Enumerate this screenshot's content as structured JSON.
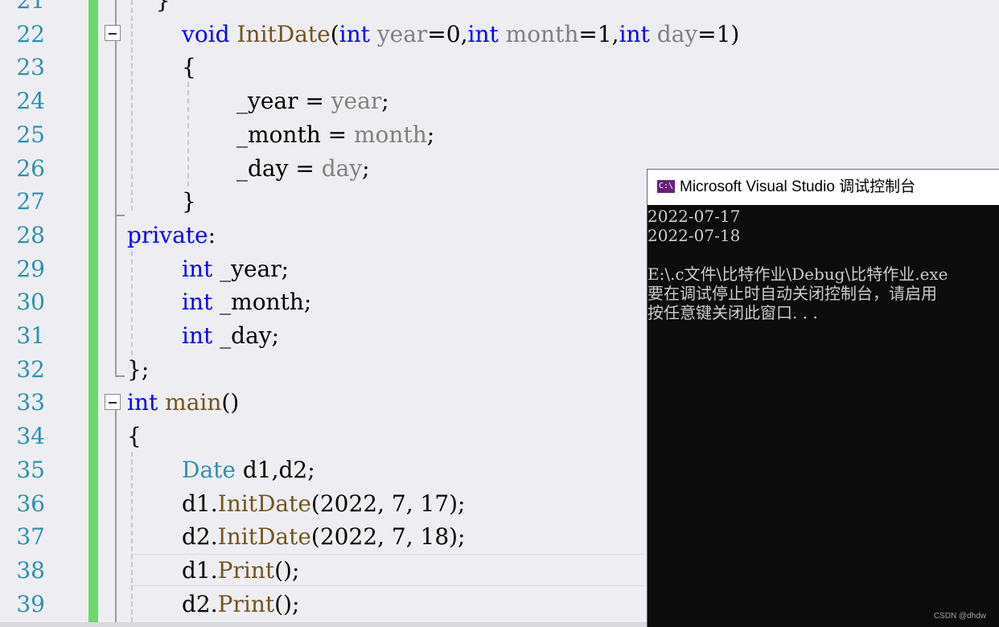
{
  "editor": {
    "lines": [
      {
        "num": "21",
        "code": [
          {
            "t": "    }",
            "c": ""
          }
        ]
      },
      {
        "num": "22",
        "code": [
          {
            "t": "void",
            "c": "kw"
          },
          {
            "t": " ",
            "c": ""
          },
          {
            "t": "InitDate",
            "c": "fn"
          },
          {
            "t": "(",
            "c": ""
          },
          {
            "t": "int",
            "c": "kw"
          },
          {
            "t": " ",
            "c": ""
          },
          {
            "t": "year",
            "c": "prm"
          },
          {
            "t": "=0,",
            "c": ""
          },
          {
            "t": "int",
            "c": "kw"
          },
          {
            "t": " ",
            "c": ""
          },
          {
            "t": "month",
            "c": "prm"
          },
          {
            "t": "=1,",
            "c": ""
          },
          {
            "t": "int",
            "c": "kw"
          },
          {
            "t": " ",
            "c": ""
          },
          {
            "t": "day",
            "c": "prm"
          },
          {
            "t": "=1)",
            "c": ""
          }
        ]
      },
      {
        "num": "23",
        "code": [
          {
            "t": "{",
            "c": ""
          }
        ]
      },
      {
        "num": "24",
        "code": [
          {
            "t": "_year = ",
            "c": ""
          },
          {
            "t": "year",
            "c": "prm"
          },
          {
            "t": ";",
            "c": ""
          }
        ]
      },
      {
        "num": "25",
        "code": [
          {
            "t": "_month = ",
            "c": ""
          },
          {
            "t": "month",
            "c": "prm"
          },
          {
            "t": ";",
            "c": ""
          }
        ]
      },
      {
        "num": "26",
        "code": [
          {
            "t": "_day = ",
            "c": ""
          },
          {
            "t": "day",
            "c": "prm"
          },
          {
            "t": ";",
            "c": ""
          }
        ]
      },
      {
        "num": "27",
        "code": [
          {
            "t": "}",
            "c": ""
          }
        ]
      },
      {
        "num": "28",
        "code": [
          {
            "t": "private",
            "c": "kw"
          },
          {
            "t": ":",
            "c": ""
          }
        ]
      },
      {
        "num": "29",
        "code": [
          {
            "t": "int",
            "c": "kw"
          },
          {
            "t": " _year;",
            "c": ""
          }
        ]
      },
      {
        "num": "30",
        "code": [
          {
            "t": "int",
            "c": "kw"
          },
          {
            "t": " _month;",
            "c": ""
          }
        ]
      },
      {
        "num": "31",
        "code": [
          {
            "t": "int",
            "c": "kw"
          },
          {
            "t": " _day;",
            "c": ""
          }
        ]
      },
      {
        "num": "32",
        "code": [
          {
            "t": "};",
            "c": ""
          }
        ]
      },
      {
        "num": "33",
        "code": [
          {
            "t": "int",
            "c": "kw"
          },
          {
            "t": " ",
            "c": ""
          },
          {
            "t": "main",
            "c": "fn"
          },
          {
            "t": "()",
            "c": ""
          }
        ]
      },
      {
        "num": "34",
        "code": [
          {
            "t": "{",
            "c": ""
          }
        ]
      },
      {
        "num": "35",
        "code": [
          {
            "t": "Date",
            "c": "typ"
          },
          {
            "t": " d1,d2;",
            "c": ""
          }
        ]
      },
      {
        "num": "36",
        "code": [
          {
            "t": "d1.",
            "c": ""
          },
          {
            "t": "InitDate",
            "c": "fn"
          },
          {
            "t": "(2022, 7, 17);",
            "c": ""
          }
        ]
      },
      {
        "num": "37",
        "code": [
          {
            "t": "d2.",
            "c": ""
          },
          {
            "t": "InitDate",
            "c": "fn"
          },
          {
            "t": "(2022, 7, 18);",
            "c": ""
          }
        ]
      },
      {
        "num": "38",
        "code": [
          {
            "t": "d1.",
            "c": ""
          },
          {
            "t": "Print",
            "c": "fn"
          },
          {
            "t": "();",
            "c": ""
          }
        ]
      },
      {
        "num": "39",
        "code": [
          {
            "t": "d2.",
            "c": ""
          },
          {
            "t": "Print",
            "c": "fn"
          },
          {
            "t": "();",
            "c": ""
          }
        ]
      }
    ]
  },
  "console": {
    "icon": "C:\\",
    "title": "Microsoft Visual Studio 调试控制台",
    "lines": [
      "2022-07-17",
      "2022-07-18",
      "",
      "E:\\.c文件\\比特作业\\Debug\\比特作业.exe",
      "要在调试停止时自动关闭控制台，请启用",
      "按任意键关闭此窗口. . ."
    ],
    "watermark": "CSDN @dhdw"
  }
}
